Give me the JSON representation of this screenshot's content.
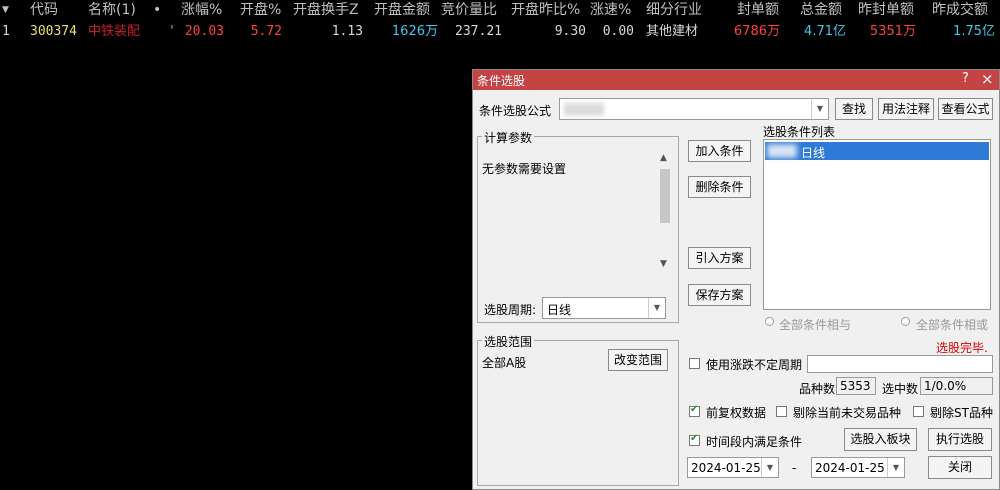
{
  "table": {
    "sort_marker": "▼",
    "headers": [
      "代码",
      "名称(1)",
      "•",
      "涨幅%",
      "开盘%",
      "开盘换手Z",
      "开盘金额",
      "竞价量比",
      "开盘昨比%",
      "涨速%",
      "细分行业",
      "封单额",
      "总金额",
      "昨封单额",
      "昨成交额"
    ],
    "row": {
      "index": "1",
      "code": "300374",
      "name": "中铁装配",
      "mark": "'",
      "change_pct": "20.03",
      "open_pct": "5.72",
      "open_turnover": "1.13",
      "open_amount": "1626万",
      "auction_ratio": "237.21",
      "open_vs_prev": "9.30",
      "speed": "0.00",
      "industry": "其他建材",
      "seal_amount": "6786万",
      "total_amount": "4.71亿",
      "prev_seal": "5351万",
      "prev_turnover": "1.75亿"
    }
  },
  "dialog": {
    "title": "条件选股",
    "help": "?",
    "close": "×",
    "formula_label": "条件选股公式",
    "formula_value": "",
    "find_btn": "查找",
    "usage_btn": "用法注释",
    "view_formula_btn": "查看公式",
    "params_group": "计算参数",
    "no_params": "无参数需要设置",
    "add_cond_btn": "加入条件",
    "del_cond_btn": "删除条件",
    "import_plan_btn": "引入方案",
    "save_plan_btn": "保存方案",
    "cond_list_label": "选股条件列表",
    "cond_items": [
      "日线"
    ],
    "period_label": "选股周期:",
    "period_value": "日线",
    "radio_and": "全部条件相与",
    "radio_or": "全部条件相或",
    "status": "选股完毕.",
    "range_group": "选股范围",
    "range_value": "全部A股",
    "change_range_btn": "改变范围",
    "use_period_label": "使用涨跌不定周期",
    "count_label": "品种数",
    "count_value": "5353",
    "selected_label": "选中数",
    "selected_value": "1/0.0%",
    "adj_label": "前复权数据",
    "exclude_untraded_label": "剔除当前未交易品种",
    "exclude_st_label": "剔除ST品种",
    "time_range_label": "时间段内满足条件",
    "to_board_btn": "选股入板块",
    "run_btn": "执行选股",
    "date_start": "2024-01-25",
    "date_sep": "-",
    "date_end": "2024-01-25",
    "close_btn": "关闭"
  },
  "colors": {
    "yellow": "#e8e070",
    "red": "#ff4040",
    "cyan": "#40c8e8",
    "white": "#d8d8d8",
    "title_red": "#c44444",
    "status_red": "#e00000"
  }
}
